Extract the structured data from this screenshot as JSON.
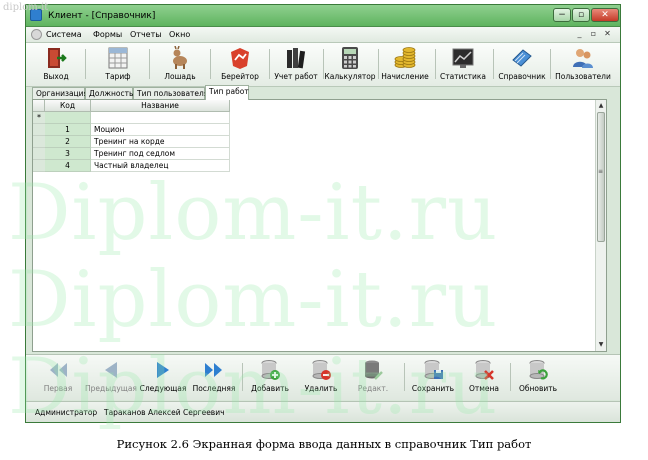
{
  "watermark": {
    "small": "diplom-it",
    "big": [
      "Diplom-it.ru",
      "Diplom-it.ru",
      "Diplom-it.ru"
    ]
  },
  "window": {
    "title": "Клиент - [Справочник]",
    "controls": {
      "minimize": "−",
      "maximize": "▫",
      "close": "✕"
    }
  },
  "menu": {
    "items": [
      "Система",
      "Формы",
      "Отчеты",
      "Окно"
    ],
    "mdi_controls": [
      "_",
      "▫",
      "✕"
    ]
  },
  "toolbar": {
    "items": [
      {
        "label": "Выход",
        "icon": "exit-door-icon"
      },
      {
        "label": "Тариф",
        "icon": "tariff-table-icon"
      },
      {
        "label": "Лошадь",
        "icon": "horse-icon"
      },
      {
        "label": "Берейтор",
        "icon": "rider-icon"
      },
      {
        "label": "Учет работ",
        "icon": "books-icon"
      },
      {
        "label": "Калькулятор",
        "icon": "calculator-icon"
      },
      {
        "label": "Начисление",
        "icon": "coins-icon"
      },
      {
        "label": "Статистика",
        "icon": "statistics-icon"
      },
      {
        "label": "Справочник",
        "icon": "reference-book-icon"
      },
      {
        "label": "Пользователи",
        "icon": "users-icon"
      }
    ]
  },
  "tabs": [
    "Организация",
    "Должность",
    "Тип пользователя",
    "Тип работ"
  ],
  "active_tab": "Тип работ",
  "grid": {
    "columns": [
      "Код",
      "Название"
    ],
    "new_row_marker": "*",
    "rows": [
      {
        "code": "1",
        "name": "Моцион"
      },
      {
        "code": "2",
        "name": "Тренинг на корде"
      },
      {
        "code": "3",
        "name": "Тренинг под седлом"
      },
      {
        "code": "4",
        "name": "Частный владелец"
      }
    ]
  },
  "navigator": {
    "items": [
      {
        "label": "Первая",
        "icon": "first-record-icon",
        "enabled": false
      },
      {
        "label": "Предыдущая",
        "icon": "prev-record-icon",
        "enabled": false
      },
      {
        "label": "Следующая",
        "icon": "next-record-icon",
        "enabled": true
      },
      {
        "label": "Последняя",
        "icon": "last-record-icon",
        "enabled": true
      },
      {
        "label": "Добавить",
        "icon": "db-add-icon",
        "enabled": true
      },
      {
        "label": "Удалить",
        "icon": "db-delete-icon",
        "enabled": true
      },
      {
        "label": "Редакт.",
        "icon": "db-edit-icon",
        "enabled": false
      },
      {
        "label": "Сохранить",
        "icon": "db-save-icon",
        "enabled": true
      },
      {
        "label": "Отмена",
        "icon": "db-cancel-icon",
        "enabled": true
      },
      {
        "label": "Обновить",
        "icon": "db-refresh-icon",
        "enabled": true
      }
    ]
  },
  "status": {
    "role": "Администратор",
    "user": "Тараканов Алексей Сергеевич"
  },
  "caption": "Рисунок 2.6 Экранная форма ввода данных в справочник  Тип работ",
  "colors": {
    "titlebar": "#5fb45f",
    "code_cell": "#cfe8cf",
    "accent_blue": "#2f7fcf"
  }
}
